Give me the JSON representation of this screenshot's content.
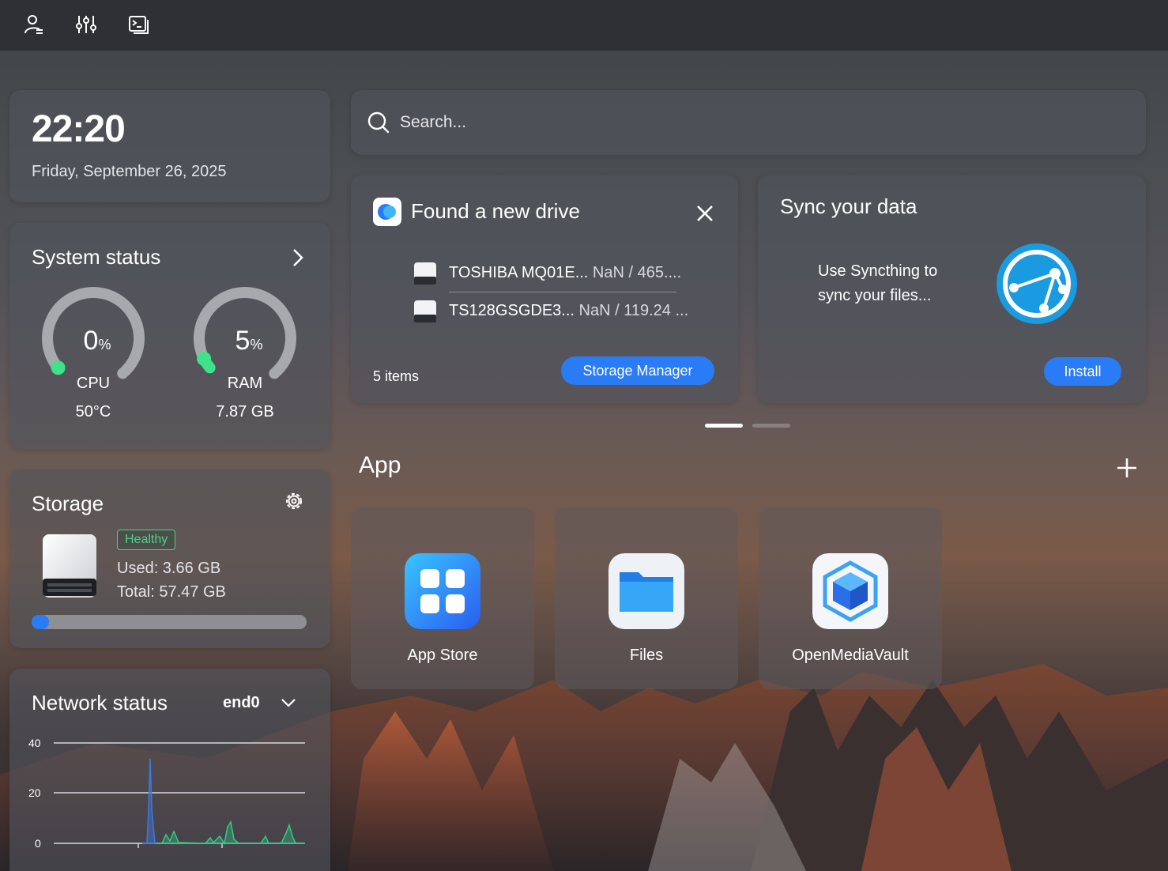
{
  "topbar": {
    "icons": [
      "user-settings-icon",
      "sliders-icon",
      "terminal-icon"
    ]
  },
  "clock": {
    "time": "22:20",
    "date": "Friday, September 26, 2025"
  },
  "system_status": {
    "title": "System status",
    "cpu": {
      "value": "0",
      "unit": "%",
      "label": "CPU",
      "sub": "50°C",
      "percent": 0
    },
    "ram": {
      "value": "5",
      "unit": "%",
      "label": "RAM",
      "sub": "7.87 GB",
      "percent": 5
    }
  },
  "storage": {
    "title": "Storage",
    "badge": "Healthy",
    "used": "Used: 3.66 GB",
    "total": "Total: 57.47 GB",
    "used_fraction": 0.064
  },
  "network": {
    "title": "Network status",
    "interface": "end0",
    "y_ticks": [
      "40",
      "20",
      "0"
    ],
    "ylim": [
      0,
      40
    ]
  },
  "search": {
    "placeholder": "Search..."
  },
  "new_drive": {
    "title": "Found a new drive",
    "drives": [
      {
        "name": "TOSHIBA MQ01E...",
        "size": "NaN / 465...."
      },
      {
        "name": "TS128GSGDE3...",
        "size": "NaN / 119.24 ..."
      }
    ],
    "count": "5 items",
    "button": "Storage Manager"
  },
  "sync": {
    "title": "Sync your data",
    "text_line1": "Use Syncthing to",
    "text_line2": "sync your files...",
    "button": "Install"
  },
  "pager": {
    "pages": 2,
    "active": 0
  },
  "apps": {
    "title": "App",
    "items": [
      {
        "label": "App Store"
      },
      {
        "label": "Files"
      },
      {
        "label": "OpenMediaVault"
      }
    ]
  },
  "colors": {
    "accent": "#2a7cf6",
    "gauge_track": "#a7a9ae",
    "gauge_dot": "#3ee28a",
    "healthy": "#4fd08a",
    "net_blue": "#3b78e0",
    "net_green": "#2ecc8a"
  }
}
